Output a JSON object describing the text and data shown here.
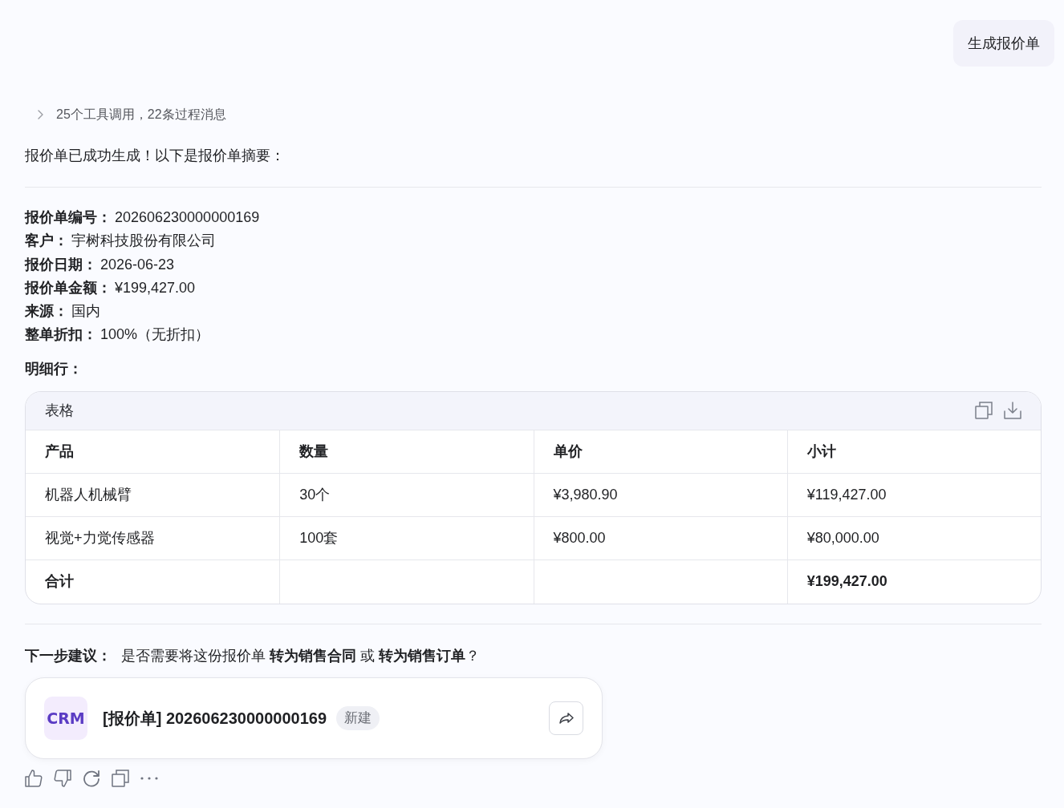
{
  "user_message": {
    "text": "生成报价单"
  },
  "process_summary": {
    "text": "25个工具调用，22条过程消息",
    "expanded": false
  },
  "intro": "报价单已成功生成！以下是报价单摘要：",
  "fields": [
    {
      "label": "报价单编号：",
      "value": "202606230000000169"
    },
    {
      "label": "客户：",
      "value": "宇树科技股份有限公司"
    },
    {
      "label": "报价日期：",
      "value": "2026-06-23"
    },
    {
      "label": "报价单金额：",
      "value": "¥199,427.00"
    },
    {
      "label": "来源：",
      "value": "国内"
    },
    {
      "label": "整单折扣：",
      "value": "100%（无折扣）"
    }
  ],
  "details_heading": "明细行：",
  "table": {
    "title": "表格",
    "columns": [
      "产品",
      "数量",
      "单价",
      "小计"
    ],
    "rows": [
      {
        "kind": "item",
        "cells": [
          "机器人机械臂",
          "30个",
          "¥3,980.90",
          "¥119,427.00"
        ]
      },
      {
        "kind": "item",
        "cells": [
          "视觉+力觉传感器",
          "100套",
          "¥800.00",
          "¥80,000.00"
        ]
      },
      {
        "kind": "total",
        "label": "合计",
        "amount": "¥199,427.00"
      }
    ]
  },
  "next_step": {
    "label": "下一步建议：",
    "text": "是否需要将这份报价单 **转为销售合同** 或 **转为销售订单**？"
  },
  "record_card": {
    "app": "CRM",
    "title": "[报价单] 202606230000000169",
    "status": "新建"
  }
}
